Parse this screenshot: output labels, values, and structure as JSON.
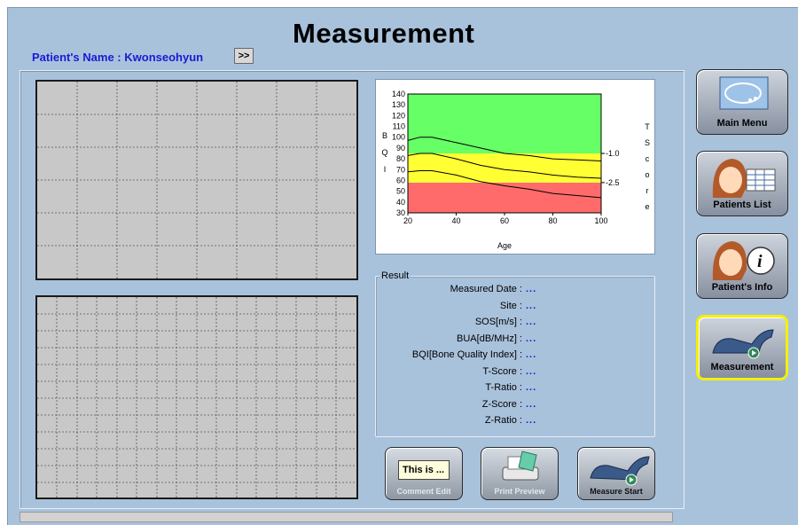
{
  "title": "Measurement",
  "patient": {
    "label": "Patient's Name : ",
    "name": "Kwonseohyun",
    "nav_button": ">>"
  },
  "chart_data": {
    "type": "line",
    "ylabel": "BQI",
    "xlabel": "Age",
    "right_label": "TScore",
    "xlim": [
      20,
      100
    ],
    "ylim": [
      30,
      140
    ],
    "x_ticks": [
      20,
      40,
      60,
      80,
      100
    ],
    "y_ticks": [
      30,
      40,
      50,
      60,
      70,
      80,
      90,
      100,
      110,
      120,
      130,
      140
    ],
    "bands": [
      {
        "from": 30,
        "to": 58,
        "color": "#ff6b6b"
      },
      {
        "from": 58,
        "to": 85,
        "color": "#ffff33"
      },
      {
        "from": 85,
        "to": 140,
        "color": "#66ff66"
      }
    ],
    "threshold_labels": [
      {
        "y": 85,
        "label": "-1.0"
      },
      {
        "y": 58,
        "label": "-2.5"
      }
    ],
    "series": [
      {
        "x": [
          20,
          25,
          30,
          40,
          50,
          60,
          70,
          80,
          90,
          100
        ],
        "values": [
          97,
          100,
          100,
          95,
          90,
          85,
          83,
          80,
          79,
          78
        ]
      },
      {
        "x": [
          20,
          25,
          30,
          40,
          50,
          60,
          70,
          80,
          90,
          100
        ],
        "values": [
          83,
          85,
          85,
          80,
          74,
          70,
          68,
          65,
          63,
          62
        ]
      },
      {
        "x": [
          20,
          25,
          30,
          40,
          50,
          60,
          70,
          80,
          90,
          100
        ],
        "values": [
          68,
          69,
          69,
          65,
          59,
          55,
          52,
          48,
          46,
          44
        ]
      }
    ]
  },
  "result": {
    "legend": "Result",
    "rows": [
      {
        "label": "Measured Date :",
        "value": "..."
      },
      {
        "label": "Site :",
        "value": "..."
      },
      {
        "label": "SOS[m/s] :",
        "value": "..."
      },
      {
        "label": "BUA[dB/MHz] :",
        "value": "..."
      },
      {
        "label": "BQI[Bone Quality Index] :",
        "value": "..."
      },
      {
        "label": "T-Score :",
        "value": "..."
      },
      {
        "label": "T-Ratio :",
        "value": "..."
      },
      {
        "label": "Z-Score :",
        "value": "..."
      },
      {
        "label": "Z-Ratio :",
        "value": "..."
      }
    ]
  },
  "bottom_buttons": {
    "comment_edit": "Comment Edit",
    "comment_preview": "This is ...",
    "print_preview": "Print Preview",
    "measure_start": "Measure Start"
  },
  "side_menu": {
    "main_menu": "Main Menu",
    "patients_list": "Patients List",
    "patients_info": "Patient's Info",
    "measurement": "Measurement"
  },
  "colors": {
    "accent_blue": "#1a1ad6",
    "selected_outline": "#f5f000",
    "background": "#a9c2dc"
  }
}
